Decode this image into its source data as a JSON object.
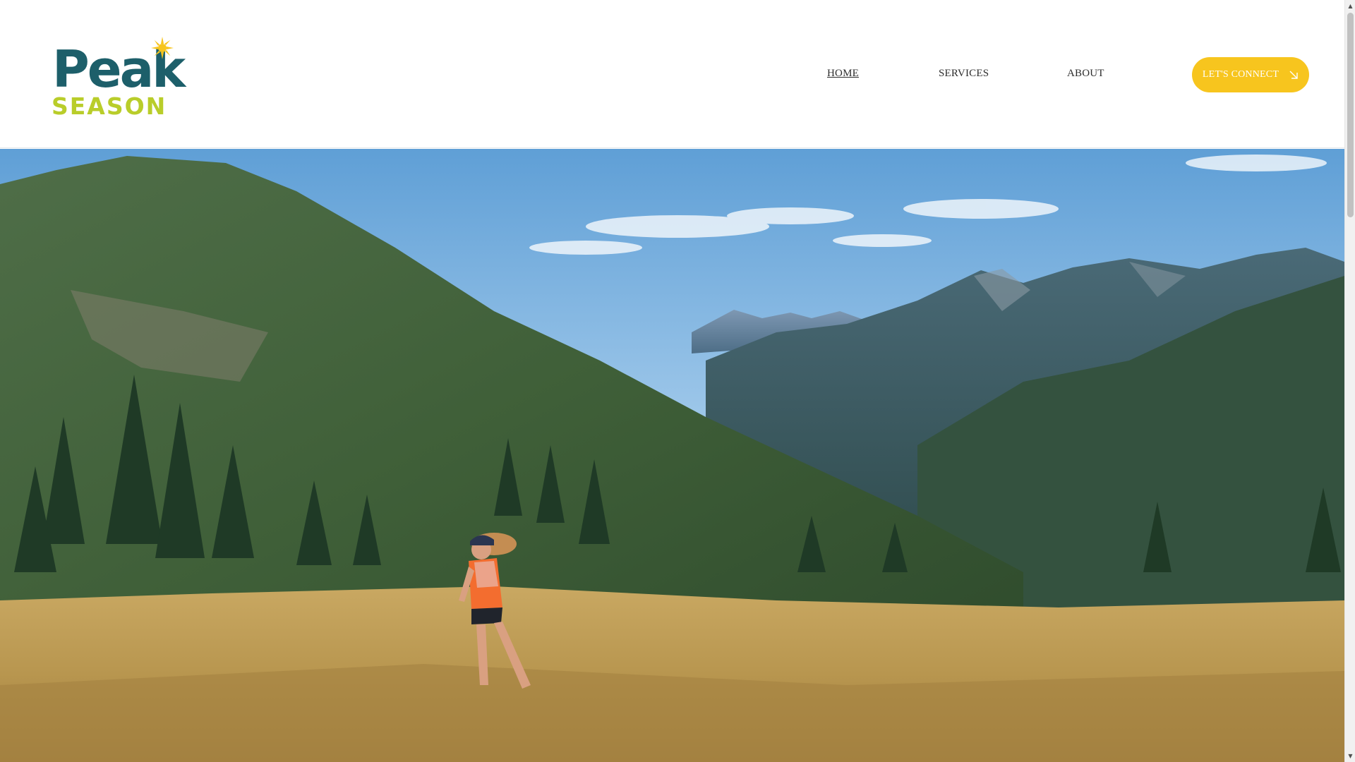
{
  "brand": {
    "name_line1": "Peak",
    "name_line2": "SEASON",
    "primary_color": "#1d5f6a",
    "secondary_color": "#b9cd2a",
    "star_color": "#f7c51e",
    "icon": "sun-star-icon"
  },
  "nav": {
    "items": [
      {
        "label": "HOME",
        "active": true
      },
      {
        "label": "SERVICES",
        "active": false
      },
      {
        "label": "ABOUT",
        "active": false
      }
    ]
  },
  "cta": {
    "label": "LET'S CONNECT",
    "icon": "arrow-down-right-icon",
    "color": "#f7c51e"
  },
  "hero": {
    "image_alt": "Trail runner in an orange shirt running across a golden alpine meadow with forested mountains behind"
  },
  "scrollbar": {
    "up_icon": "scroll-up-arrow-icon",
    "down_icon": "scroll-down-arrow-icon"
  }
}
